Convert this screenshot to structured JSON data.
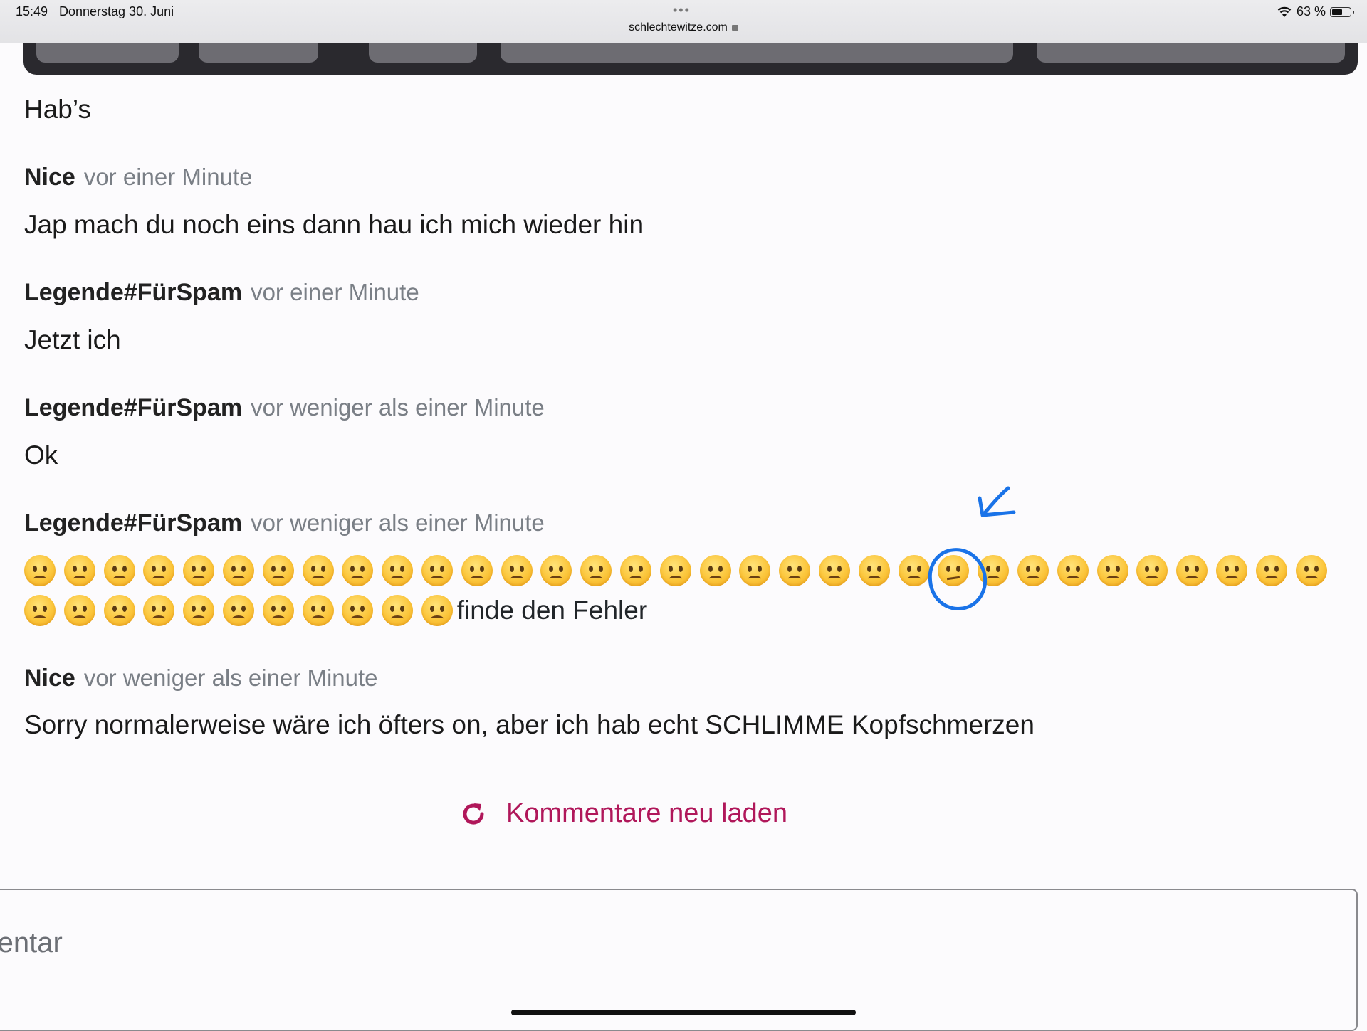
{
  "status_bar": {
    "time": "15:49",
    "date": "Donnerstag 30. Juni",
    "url": "schlechtewitze.com",
    "battery": "63 %",
    "battery_level": 0.63
  },
  "comments": [
    {
      "text": "Hab’s"
    },
    {
      "author": "Nice",
      "when": "vor einer Minute",
      "text": "Jap mach du noch eins dann hau ich mich wieder hin"
    },
    {
      "author": "Legende#FürSpam",
      "when": "vor einer Minute",
      "text": "Jetzt ich"
    },
    {
      "author": "Legende#FürSpam",
      "when": "vor weniger als einer Minute",
      "text": "Ok"
    },
    {
      "author": "Legende#FürSpam",
      "when": "vor weniger als einer Minute",
      "text": "finde den Fehler",
      "emoji": "slightly-frowning-face",
      "emoji_count_row1": 33,
      "emoji_count_row2": 11,
      "odd_emoji": "confused-face",
      "odd_index": 23
    },
    {
      "author": "Nice",
      "when": "vor weniger als einer Minute",
      "text": "Sorry normalerweise wäre ich öfters on, aber ich hab echt SCHLIMME Kopfschmerzen"
    }
  ],
  "reload_label": "Kommentare neu laden",
  "comment_placeholder": "mmentar",
  "colors": {
    "accent": "#b0175a",
    "annotation": "#1a73e8"
  }
}
